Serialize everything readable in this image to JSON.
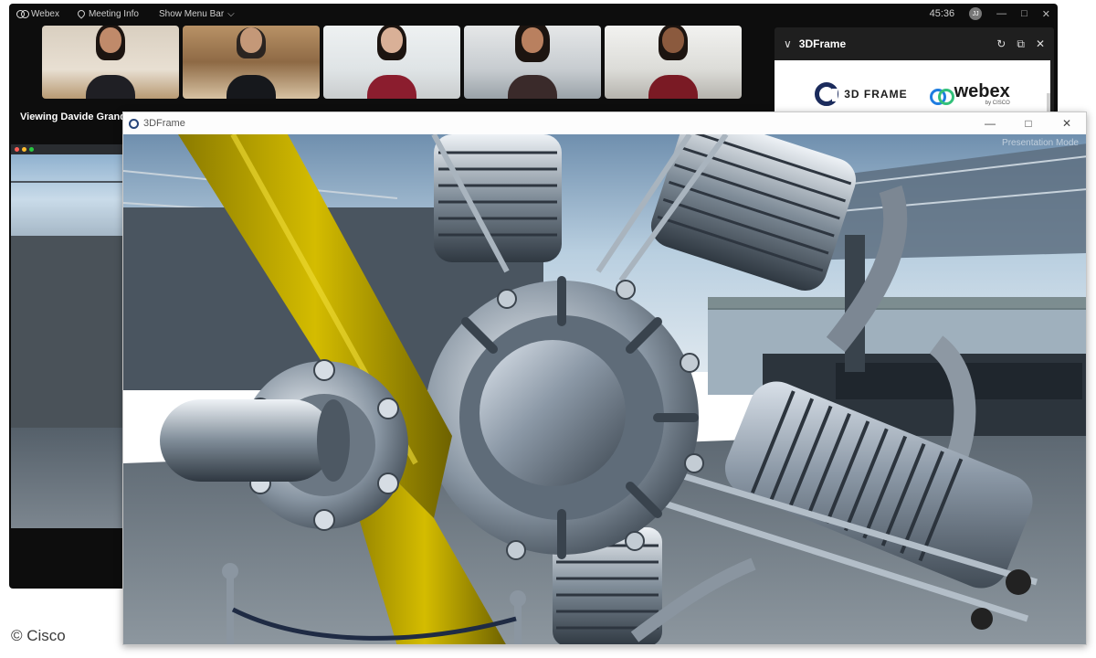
{
  "webex": {
    "app_name": "Webex",
    "meeting_info": "Meeting Info",
    "show_menu_bar": "Show Menu Bar",
    "timer": "45:36",
    "avatar_initials": "JJ",
    "minimize": "—",
    "maximize": "□",
    "close": "✕",
    "viewing_label": "Viewing Davide Grand",
    "participants": [
      {
        "tile": "participant-1"
      },
      {
        "tile": "participant-2"
      },
      {
        "tile": "participant-3"
      },
      {
        "tile": "participant-4"
      },
      {
        "tile": "participant-5"
      }
    ]
  },
  "panel": {
    "title": "3DFrame",
    "chevron": "∨",
    "refresh_icon": "↻",
    "popout_icon": "⧉",
    "close_icon": "✕",
    "logo_3d_text": "3D FRAME",
    "logo_webex_text": "webex",
    "logo_webex_sub": "by CISCO"
  },
  "frame_window": {
    "title": "3DFrame",
    "minimize": "—",
    "maximize": "□",
    "close": "✕",
    "overlay_text": "Presentation Mode"
  },
  "colors": {
    "webex_bg": "#0d0d0d",
    "propeller": "#c9b000",
    "engine_metal": "#8a98a6"
  },
  "footer": {
    "copyright": "© Cisco"
  }
}
